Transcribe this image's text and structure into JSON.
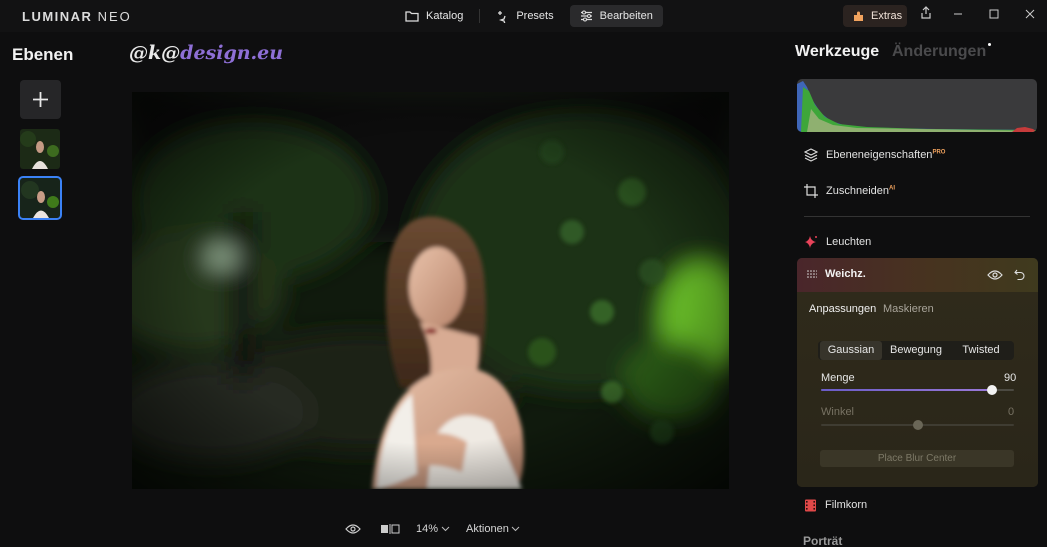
{
  "app": {
    "logo_main": "LUMINAR",
    "logo_sub": "NEO"
  },
  "nav": {
    "catalog": "Katalog",
    "presets": "Presets",
    "edit": "Bearbeiten",
    "extras": "Extras"
  },
  "layers": {
    "title": "Ebenen",
    "add_icon": "plus-icon"
  },
  "watermark": {
    "prefix": "@k@",
    "suffix": "design.eu"
  },
  "bottom": {
    "zoom": "14%",
    "actions": "Aktionen"
  },
  "right": {
    "tab_tools": "Werkzeuge",
    "tab_changes": "Änderungen",
    "tools": [
      {
        "label": "Ebeneneigenschaften",
        "badge": "PRO",
        "icon": "layers-icon"
      },
      {
        "label": "Zuschneiden",
        "badge": "AI",
        "icon": "crop-icon"
      },
      {
        "label": "Leuchten",
        "badge": "",
        "icon": "sparkle-icon"
      }
    ],
    "active_tool": {
      "title": "Weichz.",
      "subtabs": [
        "Anpassungen",
        "Maskieren"
      ],
      "modes": [
        "Gaussian",
        "Bewegung",
        "Twisted"
      ],
      "selected_mode": "Gaussian",
      "sliders": [
        {
          "label": "Menge",
          "value": "90",
          "fraction": 0.9
        },
        {
          "label": "Winkel",
          "value": "0",
          "fraction": 0.5
        }
      ],
      "button": "Place Blur Center"
    },
    "next_tool": {
      "label": "Filmkorn",
      "icon": "film-grain-icon"
    },
    "section": "Porträt"
  },
  "colors": {
    "accent_blue": "#3b82f6",
    "extras_orange": "#f2a35e",
    "leuchten_red": "#e8435a",
    "filmkorn_red": "#e04848"
  }
}
